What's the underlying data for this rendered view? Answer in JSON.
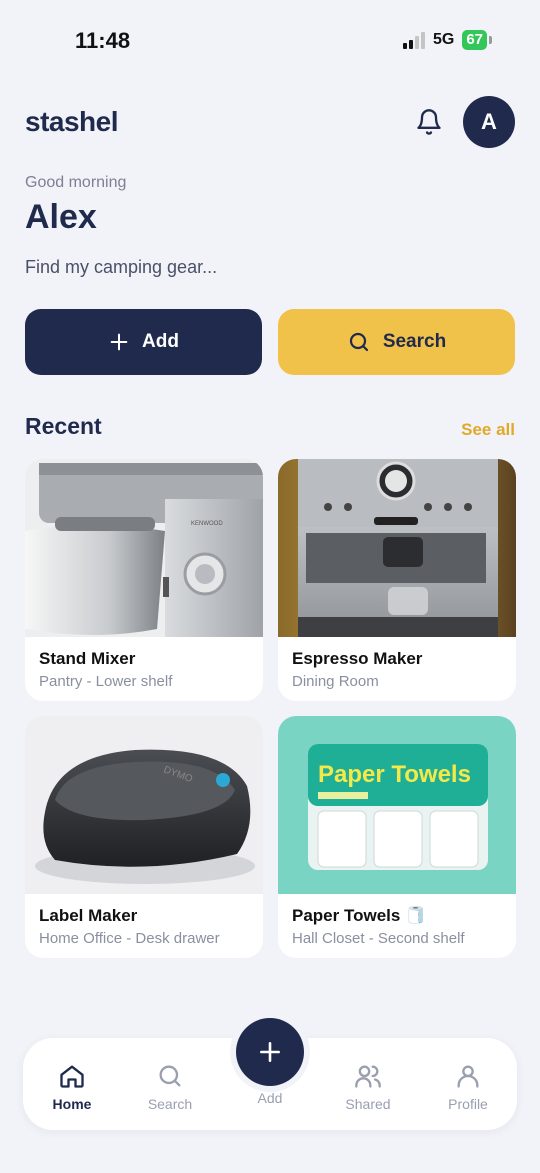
{
  "status": {
    "time": "11:48",
    "network": "5G",
    "battery": "67"
  },
  "header": {
    "logo": "stashel",
    "avatar_initial": "A"
  },
  "home": {
    "greeting": "Good morning",
    "name": "Alex",
    "prompt": "Find my camping gear...",
    "add_label": "Add",
    "search_label": "Search"
  },
  "recent": {
    "title": "Recent",
    "see_all": "See all",
    "items": [
      {
        "title": "Stand Mixer",
        "location": "Pantry - Lower shelf",
        "icon": "stand-mixer-photo"
      },
      {
        "title": "Espresso Maker",
        "location": "Dining Room",
        "icon": "espresso-maker-photo"
      },
      {
        "title": "Label Maker",
        "location": "Home Office - Desk drawer",
        "icon": "label-maker-photo"
      },
      {
        "title": "Paper Towels 🧻",
        "location": "Hall Closet - Second shelf",
        "icon": "paper-towels-photo",
        "package_text": "Paper Towels"
      }
    ]
  },
  "tabs": [
    {
      "label": "Home",
      "icon": "home-icon",
      "active": true
    },
    {
      "label": "Search",
      "icon": "search-icon",
      "active": false
    },
    {
      "label": "Add",
      "icon": "plus-icon",
      "active": false
    },
    {
      "label": "Shared",
      "icon": "users-icon",
      "active": false
    },
    {
      "label": "Profile",
      "icon": "user-icon",
      "active": false
    }
  ],
  "colors": {
    "navy": "#1f2a4d",
    "accent": "#f0c24a",
    "background": "#f2f3f8",
    "battery": "#33c759"
  }
}
